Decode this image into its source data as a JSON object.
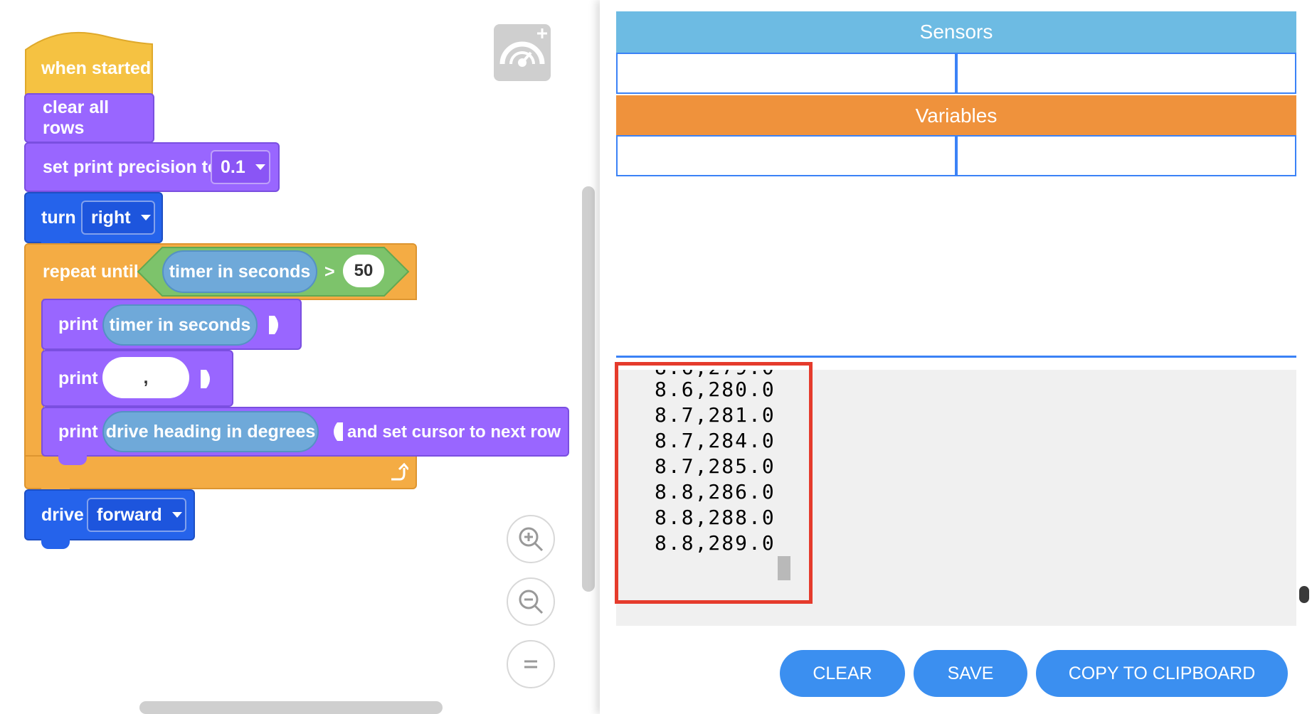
{
  "blocks": {
    "when_started": "when started",
    "clear_all_rows": "clear all rows",
    "set_precision_label": "set print precision to",
    "set_precision_value": "0.1",
    "turn_label": "turn",
    "turn_direction": "right",
    "repeat_until_label": "repeat until",
    "timer_reporter": "timer in seconds",
    "greater_than": ">",
    "compare_value": "50",
    "print_label": "print",
    "print_string_value": ",",
    "heading_reporter": "drive heading in degrees",
    "next_row_label": "and set cursor to next row",
    "drive_label": "drive",
    "drive_direction": "forward"
  },
  "colors": {
    "event": "#f5c242",
    "looks": "#9966ff",
    "motion": "#2563eb",
    "control": "#f4ac44",
    "operator": "#7dc36b",
    "sensing": "#6fa9d9",
    "sensors_header": "#6dbbe3",
    "variables_header": "#ef923c",
    "button": "#3b8ff0",
    "highlight": "#e53b2c"
  },
  "icons": {
    "dashboard": "dashboard-add-icon",
    "zoom_in": "zoom-in-icon",
    "zoom_out": "zoom-out-icon",
    "reset_zoom": "reset-zoom-icon",
    "loop_arrow": "loop-arrow-icon"
  },
  "panel": {
    "sensors_title": "Sensors",
    "variables_title": "Variables"
  },
  "console": {
    "lines": [
      "8.6,280.0",
      "8.7,281.0",
      "8.7,284.0",
      "8.7,285.0",
      "8.8,286.0",
      "8.8,288.0",
      "8.8,289.0"
    ]
  },
  "buttons": {
    "clear": "CLEAR",
    "save": "SAVE",
    "copy": "COPY TO CLIPBOARD"
  }
}
